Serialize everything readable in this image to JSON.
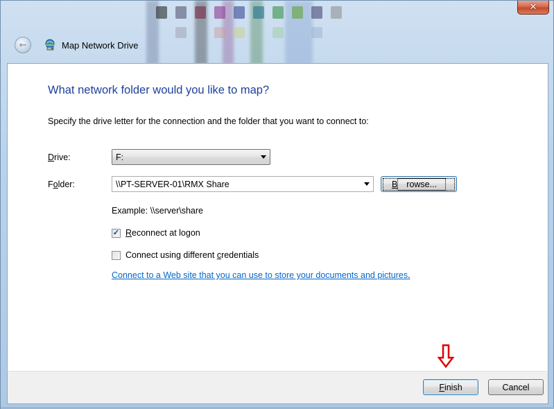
{
  "window": {
    "title": "Map Network Drive",
    "close_glyph": "✕"
  },
  "nav": {
    "back_icon": "back-arrow-icon",
    "title_icon": "network-drive-icon"
  },
  "main": {
    "heading": "What network folder would you like to map?",
    "instructions": "Specify the drive letter for the connection and the folder that you want to connect to:",
    "drive": {
      "label_prefix": "",
      "label_accel": "D",
      "label_rest": "rive:",
      "value": "F:"
    },
    "folder": {
      "label_prefix": "F",
      "label_accel": "o",
      "label_rest": "lder:",
      "value": "\\\\PT-SERVER-01\\RMX Share"
    },
    "browse": {
      "label_accel": "B",
      "label_rest": "rowse..."
    },
    "example": "Example: \\\\server\\share",
    "reconnect": {
      "checked": true,
      "check_glyph": "✓",
      "label_accel": "R",
      "label_rest": "econnect at logon"
    },
    "credentials": {
      "checked": false,
      "label_prefix": "Connect using different ",
      "label_accel": "c",
      "label_rest": "redentials"
    },
    "web_link": "Connect to a Web site that you can use to store your documents and pictures",
    "web_link_period": "."
  },
  "footer": {
    "finish": {
      "label_accel": "F",
      "label_rest": "inish"
    },
    "cancel": "Cancel"
  },
  "colors": {
    "heading": "#1e3f9c",
    "link": "#0066cc",
    "annotation_arrow": "#e00000"
  }
}
